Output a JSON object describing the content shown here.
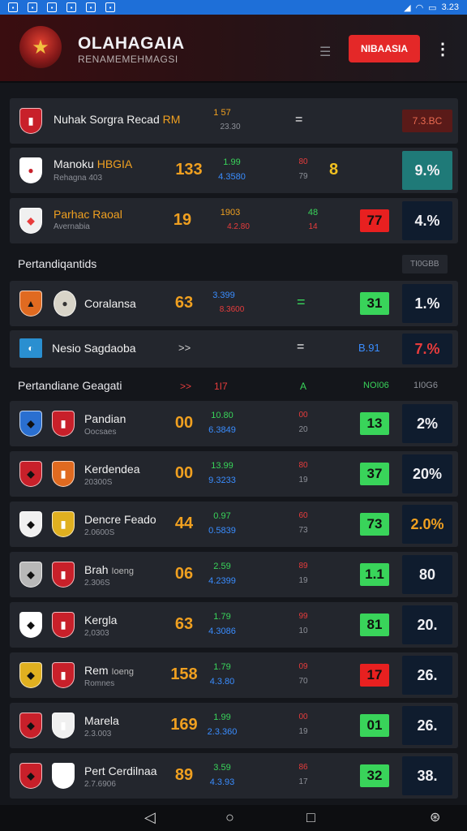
{
  "status_bar": {
    "time": "3.23"
  },
  "header": {
    "title": "OLAHAGAIA",
    "subtitle": "RENAMEMEHMAGSI",
    "live_button": "NIBAASIA"
  },
  "top_rows": [
    {
      "name": "Nuhak Sorgra Recad",
      "name_tag": "RM",
      "odd1": "1 57",
      "odd2": "23.30",
      "mid": "=",
      "badge": "7.3.BC"
    },
    {
      "name": "Manoku",
      "name_tag": "HBGIA",
      "sub": "Rehagna 403",
      "score": "133",
      "odd1": "1.99",
      "odd2": "4.3580",
      "odd3": "80",
      "odd4": "79",
      "icon_char": "8",
      "pct": "9.%"
    },
    {
      "name": "Parhac Raoal",
      "sub": "Avernabia",
      "score": "19",
      "odd1": "1903",
      "odd2": "4.2.80",
      "odd3": "48",
      "odd4": "14",
      "badge": "77",
      "pct": "4.%"
    }
  ],
  "section1": {
    "title": "Pertandiqantids",
    "tag": "TI0GBB"
  },
  "mid_rows": [
    {
      "name": "Coralansa",
      "score": "63",
      "odd1": "3.399",
      "odd2": "8.3600",
      "mid": "=",
      "badge": "31",
      "pct": "1.%"
    },
    {
      "name": "Nesio Sagdaoba",
      "arrow": ">>",
      "mid": "=",
      "odd1": "B.91",
      "pct": "7.%"
    }
  ],
  "section2": {
    "title": "Pertandiane Geagati",
    "col1": ">>",
    "col2": "1I7",
    "col3": "A",
    "col4": "NOI06",
    "col5": "1I0G6"
  },
  "match_rows": [
    {
      "name": "Pandian",
      "sub": "Oocsaes",
      "score": "00",
      "odd1": "10.80",
      "odd2": "6.3849",
      "odd3": "00",
      "odd4": "20",
      "badge": "13",
      "badge_color": "green",
      "pct": "2%",
      "pct_color": "#f0f0f4"
    },
    {
      "name": "Kerdendea",
      "sub": "20300S",
      "score": "00",
      "odd1": "13.99",
      "odd2": "9.3233",
      "odd3": "80",
      "odd4": "19",
      "badge": "37",
      "badge_color": "green",
      "pct": "20%",
      "pct_color": "#f0f0f4"
    },
    {
      "name": "Dencre Feado",
      "sub": "2.0600S",
      "score": "44",
      "odd1": "0.97",
      "odd2": "0.5839",
      "odd3": "60",
      "odd4": "73",
      "badge": "73",
      "badge_color": "green",
      "pct": "2.0%",
      "pct_color": "#f0a020"
    },
    {
      "name": "Brah",
      "name_extra": "Ioeng",
      "sub": "2.306S",
      "score": "06",
      "odd1": "2.59",
      "odd2": "4.2399",
      "odd3": "89",
      "odd4": "19",
      "badge": "1.1",
      "badge_color": "green",
      "pct": "80",
      "pct_color": "#f0f0f4"
    },
    {
      "name": "Kergla",
      "sub": "2,0303",
      "score": "63",
      "odd1": "1.79",
      "odd2": "4.3086",
      "odd3": "99",
      "odd4": "10",
      "badge": "81",
      "badge_color": "green",
      "pct": "20.",
      "pct_color": "#f0f0f4"
    },
    {
      "name": "Rem",
      "name_extra": "Ioeng",
      "sub": "Romnes",
      "score": "158",
      "odd1": "1.79",
      "odd2": "4.3.80",
      "odd3": "09",
      "odd4": "70",
      "badge": "17",
      "badge_color": "red",
      "pct": "26.",
      "pct_color": "#f0f0f4"
    },
    {
      "name": "Marela",
      "sub": "2.3.003",
      "score": "169",
      "odd1": "1.99",
      "odd2": "2.3.360",
      "odd3": "00",
      "odd4": "19",
      "badge": "01",
      "badge_color": "green",
      "pct": "26.",
      "pct_color": "#f0f0f4"
    },
    {
      "name": "Pert Cerdilnaa",
      "sub": "2.7.6906",
      "score": "89",
      "odd1": "3.59",
      "odd2": "4.3.93",
      "odd3": "86",
      "odd4": "17",
      "badge": "32",
      "badge_color": "green",
      "pct": "38.",
      "pct_color": "#f0f0f4"
    }
  ],
  "colors": {
    "accent_red": "#e42828",
    "green": "#39d45a",
    "orange": "#f0a020",
    "blue": "#3a8dff",
    "bg": "#14161b"
  },
  "nav": {
    "back": "back-icon",
    "home": "home-icon",
    "recents": "recents-icon",
    "extra": "gamepad-icon"
  }
}
